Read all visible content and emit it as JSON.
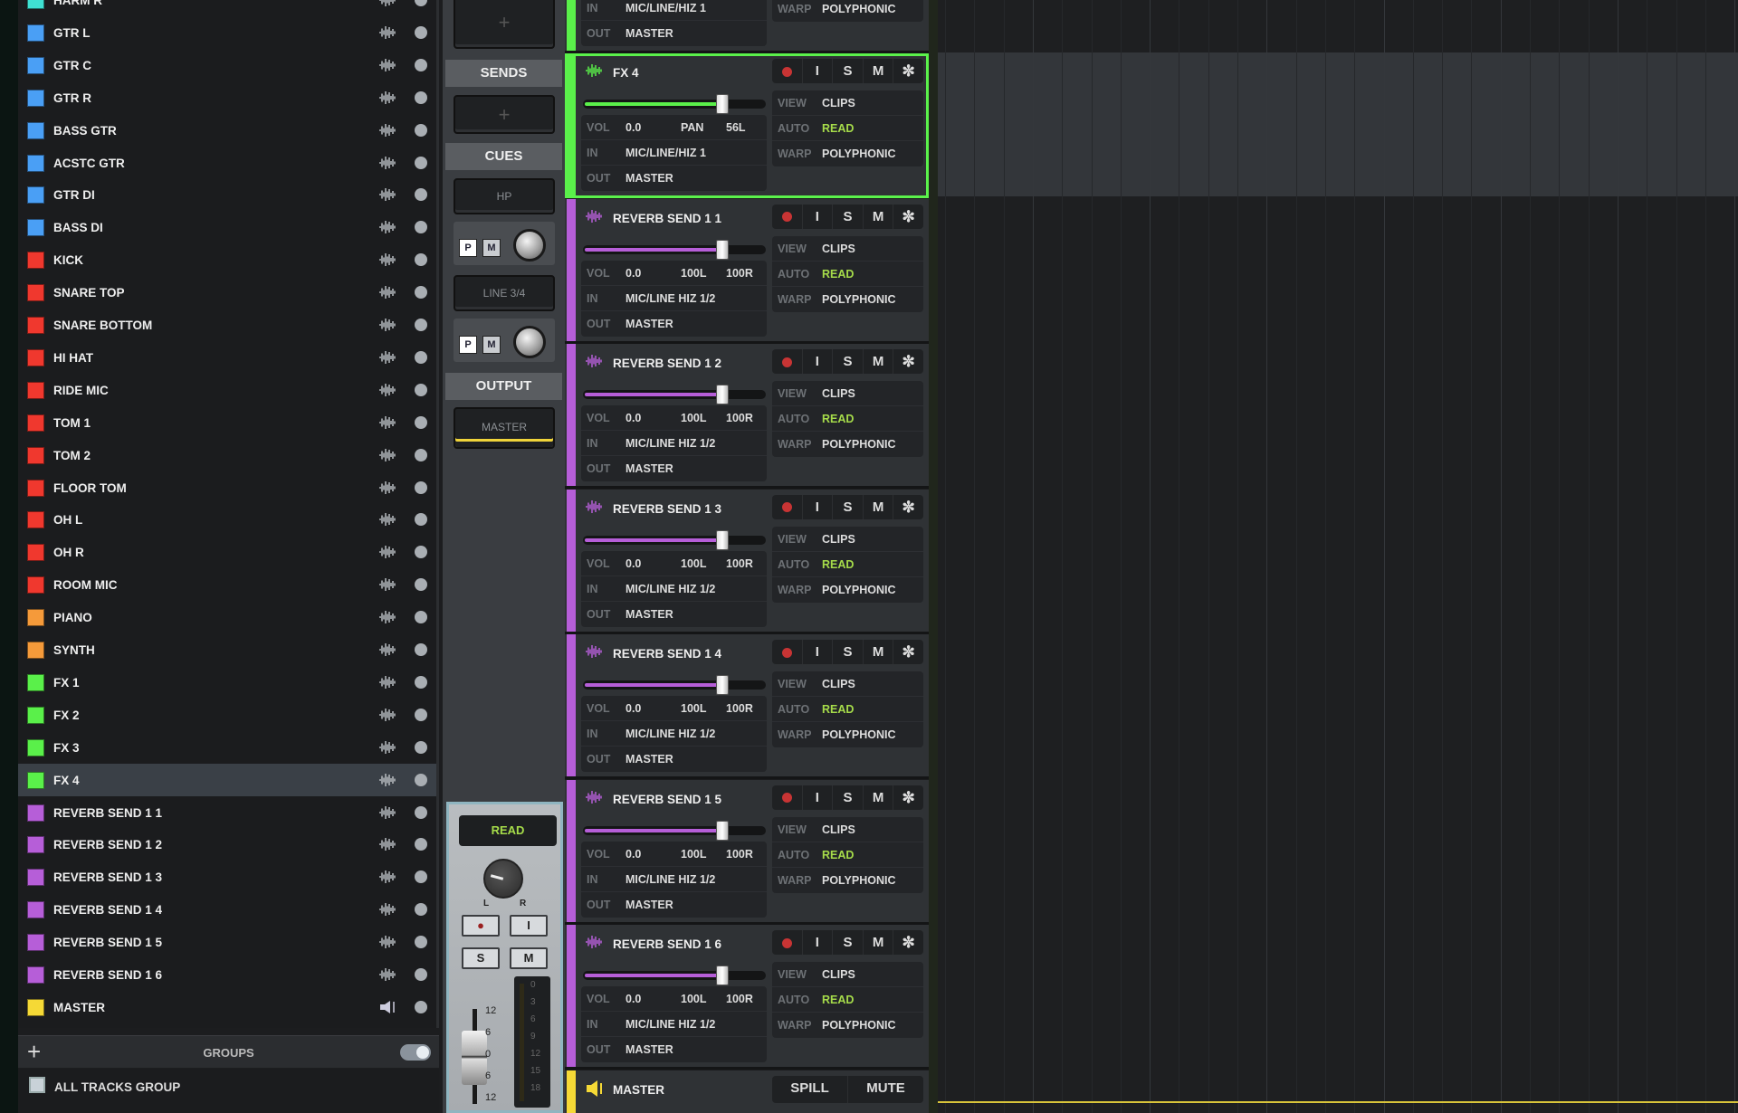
{
  "track_list": [
    {
      "name": "HARM R",
      "color": "#3fe0d2"
    },
    {
      "name": "GTR L",
      "color": "#4a9ff5"
    },
    {
      "name": "GTR C",
      "color": "#4a9ff5"
    },
    {
      "name": "GTR R",
      "color": "#4a9ff5"
    },
    {
      "name": "BASS GTR",
      "color": "#4a9ff5"
    },
    {
      "name": "ACSTC GTR",
      "color": "#4a9ff5"
    },
    {
      "name": "GTR DI",
      "color": "#4a9ff5"
    },
    {
      "name": "BASS DI",
      "color": "#4a9ff5"
    },
    {
      "name": "KICK",
      "color": "#f0382e"
    },
    {
      "name": "SNARE TOP",
      "color": "#f0382e"
    },
    {
      "name": "SNARE BOTTOM",
      "color": "#f0382e"
    },
    {
      "name": "HI HAT",
      "color": "#f0382e"
    },
    {
      "name": "RIDE MIC",
      "color": "#f0382e"
    },
    {
      "name": "TOM 1",
      "color": "#f0382e"
    },
    {
      "name": "TOM 2",
      "color": "#f0382e"
    },
    {
      "name": "FLOOR TOM",
      "color": "#f0382e"
    },
    {
      "name": "OH L",
      "color": "#f0382e"
    },
    {
      "name": "OH R",
      "color": "#f0382e"
    },
    {
      "name": "ROOM MIC",
      "color": "#f0382e"
    },
    {
      "name": "PIANO",
      "color": "#f59a3a"
    },
    {
      "name": "SYNTH",
      "color": "#f59a3a"
    },
    {
      "name": "FX 1",
      "color": "#5af04a"
    },
    {
      "name": "FX 2",
      "color": "#5af04a"
    },
    {
      "name": "FX 3",
      "color": "#5af04a"
    },
    {
      "name": "FX 4",
      "color": "#5af04a",
      "selected": true
    },
    {
      "name": "REVERB SEND 1 1",
      "color": "#b65ed8"
    },
    {
      "name": "REVERB SEND 1 2",
      "color": "#b65ed8"
    },
    {
      "name": "REVERB SEND 1 3",
      "color": "#b65ed8"
    },
    {
      "name": "REVERB SEND 1 4",
      "color": "#b65ed8"
    },
    {
      "name": "REVERB SEND 1 5",
      "color": "#b65ed8"
    },
    {
      "name": "REVERB SEND 1 6",
      "color": "#b65ed8"
    },
    {
      "name": "MASTER",
      "color": "#f5d936",
      "icon": "speaker-icon"
    }
  ],
  "groups": {
    "label": "GROUPS",
    "add": "+",
    "items": [
      "ALL TRACKS GROUP"
    ]
  },
  "middle": {
    "top_add": "+",
    "sends_label": "SENDS",
    "sends_add": "+",
    "cues_label": "CUES",
    "cues": [
      {
        "output": "HP",
        "p": "P",
        "m": "M"
      },
      {
        "output": "LINE 3/4",
        "p": "P",
        "m": "M"
      }
    ],
    "output_label": "OUTPUT",
    "output_value": "MASTER",
    "strip": {
      "auto": "READ",
      "pan_l": "L",
      "pan_r": "R",
      "rec": "●",
      "input": "I",
      "solo": "S",
      "mute": "M",
      "fader_scale": [
        "12",
        "6",
        "0",
        "6",
        "12"
      ],
      "meter_scale": [
        "0",
        "3",
        "6",
        "9",
        "12",
        "15",
        "18"
      ]
    }
  },
  "inspector": {
    "labels": {
      "vol": "VOL",
      "pan": "PAN",
      "in": "IN",
      "out": "OUT",
      "view": "VIEW",
      "auto": "AUTO",
      "warp": "WARP",
      "input": "I",
      "solo": "S",
      "mute": "M"
    },
    "partial_top": {
      "color": "#5af04a",
      "in": "MIC/LINE/HIZ 1",
      "out": "MASTER",
      "warp": "POLYPHONIC"
    },
    "tracks": [
      {
        "name": "FX 4",
        "color": "#5af04a",
        "selected": true,
        "vol": "0.0",
        "pan_label": "PAN",
        "pan": "56L",
        "in": "MIC/LINE/HIZ 1",
        "out": "MASTER",
        "view": "CLIPS",
        "auto": "READ",
        "warp": "POLYPHONIC",
        "fader": 0.76
      },
      {
        "name": "REVERB SEND 1 1",
        "color": "#b65ed8",
        "vol": "0.0",
        "pan_label": "100L",
        "pan": "100R",
        "in": "MIC/LINE HIZ 1/2",
        "out": "MASTER",
        "view": "CLIPS",
        "auto": "READ",
        "warp": "POLYPHONIC",
        "fader": 0.76
      },
      {
        "name": "REVERB SEND 1 2",
        "color": "#b65ed8",
        "vol": "0.0",
        "pan_label": "100L",
        "pan": "100R",
        "in": "MIC/LINE HIZ 1/2",
        "out": "MASTER",
        "view": "CLIPS",
        "auto": "READ",
        "warp": "POLYPHONIC",
        "fader": 0.76
      },
      {
        "name": "REVERB SEND 1 3",
        "color": "#b65ed8",
        "vol": "0.0",
        "pan_label": "100L",
        "pan": "100R",
        "in": "MIC/LINE HIZ 1/2",
        "out": "MASTER",
        "view": "CLIPS",
        "auto": "READ",
        "warp": "POLYPHONIC",
        "fader": 0.76
      },
      {
        "name": "REVERB SEND 1 4",
        "color": "#b65ed8",
        "vol": "0.0",
        "pan_label": "100L",
        "pan": "100R",
        "in": "MIC/LINE HIZ 1/2",
        "out": "MASTER",
        "view": "CLIPS",
        "auto": "READ",
        "warp": "POLYPHONIC",
        "fader": 0.76
      },
      {
        "name": "REVERB SEND 1 5",
        "color": "#b65ed8",
        "vol": "0.0",
        "pan_label": "100L",
        "pan": "100R",
        "in": "MIC/LINE HIZ 1/2",
        "out": "MASTER",
        "view": "CLIPS",
        "auto": "READ",
        "warp": "POLYPHONIC",
        "fader": 0.76
      },
      {
        "name": "REVERB SEND 1 6",
        "color": "#b65ed8",
        "vol": "0.0",
        "pan_label": "100L",
        "pan": "100R",
        "in": "MIC/LINE HIZ 1/2",
        "out": "MASTER",
        "view": "CLIPS",
        "auto": "READ",
        "warp": "POLYPHONIC",
        "fader": 0.76
      }
    ],
    "master": {
      "name": "MASTER",
      "color": "#f5d936",
      "spill": "SPILL",
      "mute": "MUTE"
    }
  },
  "colors": {
    "selected_outline": "#5bf24b",
    "auto_read": "#a6dc4a",
    "master_line": "#d9c43a"
  }
}
